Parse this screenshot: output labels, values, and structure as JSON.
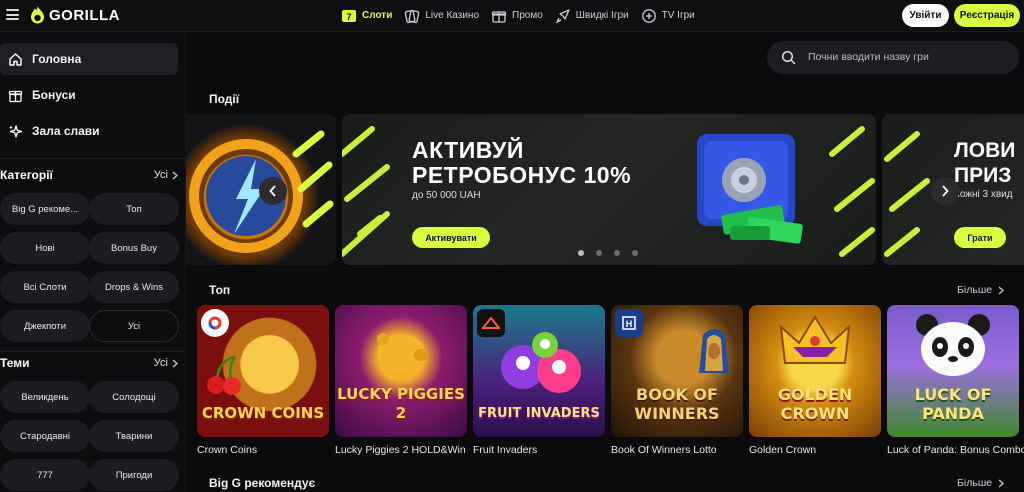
{
  "brand": {
    "name": "GORILLA",
    "accent": "#d8ff3d"
  },
  "nav": [
    {
      "label": "Слоти",
      "icon": "slots-icon",
      "active": true
    },
    {
      "label": "Live Казино",
      "icon": "cards-icon"
    },
    {
      "label": "Промо",
      "icon": "gift-icon"
    },
    {
      "label": "Швидкі Ігри",
      "icon": "rocket-icon"
    },
    {
      "label": "TV Ігри",
      "icon": "tv-games-icon"
    }
  ],
  "auth": {
    "login": "Увійти",
    "register": "Реєстрація"
  },
  "sidebar": {
    "items": [
      {
        "label": "Головна",
        "icon": "home-icon"
      },
      {
        "label": "Бонуси",
        "icon": "gift-icon"
      },
      {
        "label": "Зала слави",
        "icon": "sparkle-icon"
      }
    ],
    "categories": {
      "title": "Категорії",
      "all": "Усі",
      "chips": [
        "Big G рекоме...",
        "Топ",
        "Нові",
        "Bonus Buy",
        "Всі Слоти",
        "Drops & Wins",
        "Джекпоти",
        "Усі"
      ]
    },
    "themes": {
      "title": "Теми",
      "all": "Усі",
      "chips": [
        "Великдень",
        "Солодощі",
        "Стародавні",
        "Тварини",
        "777",
        "Пригоди"
      ]
    }
  },
  "search": {
    "placeholder": "Почни вводити назву гри"
  },
  "events": {
    "title": "Події",
    "main": {
      "title_line1": "АКТИВУЙ",
      "title_line2": "РЕТРОБОНУС 10%",
      "subtitle": "до 50 000 UAH",
      "button": "Активувати"
    },
    "next": {
      "title_line1": "ЛОВИ",
      "title_line2": "ПРИЗ",
      "subtitle": "Кожні 3 хвид",
      "button": "Грати"
    },
    "dots": 4,
    "active_dot": 0
  },
  "top": {
    "title": "Топ",
    "more": "Більше",
    "games": [
      {
        "title": "Crown Coins",
        "art": "CROWN COINS"
      },
      {
        "title": "Lucky Piggies 2 HOLD&Win",
        "art": "LUCKY PIGGIES 2"
      },
      {
        "title": "Fruit Invaders",
        "art": "FRUIT INVADERS"
      },
      {
        "title": "Book Of Winners Lotto",
        "art": "BOOK OF WINNERS"
      },
      {
        "title": "Golden Crown",
        "art": "GOLDEN CROWN"
      },
      {
        "title": "Luck of Panda: Bonus Combo",
        "art": "LUCK OF PANDA"
      }
    ]
  },
  "recommend": {
    "title": "Big G рекомендує",
    "more": "Більше"
  }
}
